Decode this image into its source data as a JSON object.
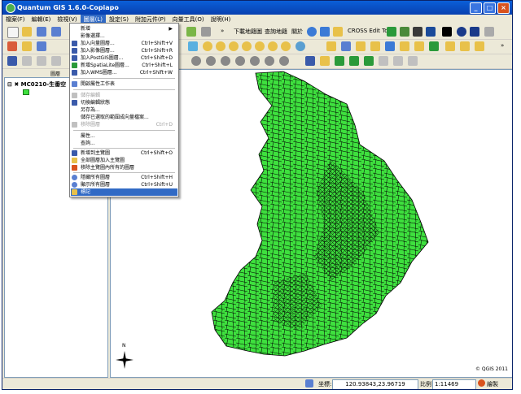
{
  "window": {
    "title": "Quantum GIS 1.6.0-Copiapo",
    "minimize": "_",
    "maximize": "□",
    "close": "×"
  },
  "menubar": [
    {
      "label": "檔案(F)"
    },
    {
      "label": "編輯(E)"
    },
    {
      "label": "檢視(V)"
    },
    {
      "label": "圖層(L)"
    },
    {
      "label": "設定(S)"
    },
    {
      "label": "附加元件(P)"
    },
    {
      "label": "向量工具(O)"
    },
    {
      "label": "說明(H)"
    }
  ],
  "toolbar": {
    "download_map": "下載地籍圖",
    "query_map": "查詢地籍",
    "about": "關於",
    "cross_edit": "CROSS Edit Tool",
    "more_top": "»",
    "more_mid": "»"
  },
  "legend": {
    "title": "圖層",
    "layer_name": "MC0210-生番空"
  },
  "layer_menu": {
    "items": [
      {
        "label": "新增",
        "shortcut": ""
      },
      {
        "label": "影像選擇...",
        "shortcut": ""
      },
      {
        "label": "加入向量圖層...",
        "shortcut": "Ctrl+Shift+V"
      },
      {
        "label": "加入影像圖層...",
        "shortcut": "Ctrl+Shift+R"
      },
      {
        "label": "加入PostGIS圖層...",
        "shortcut": "Ctrl+Shift+D"
      },
      {
        "label": "新增SpatiaLite圖層...",
        "shortcut": "Ctrl+Shift+L"
      },
      {
        "label": "加入WMS圖層...",
        "shortcut": "Ctrl+Shift+W"
      },
      {
        "label": "開啟屬性工作表",
        "shortcut": ""
      },
      {
        "label": "儲存編輯",
        "shortcut": ""
      },
      {
        "label": "切換編輯狀態",
        "shortcut": ""
      },
      {
        "label": "另存為...",
        "shortcut": ""
      },
      {
        "label": "儲存已選取的範圍成向量檔案...",
        "shortcut": ""
      },
      {
        "label": "移除圖層",
        "shortcut": "Ctrl+D"
      },
      {
        "label": "屬性...",
        "shortcut": ""
      },
      {
        "label": "查詢...",
        "shortcut": ""
      },
      {
        "label": "新增到主覽圖",
        "shortcut": "Ctrl+Shift+O"
      },
      {
        "label": "全部圖層加入主覽圖",
        "shortcut": ""
      },
      {
        "label": "移除主覽圖內所有的圖層",
        "shortcut": ""
      },
      {
        "label": "隱藏所有圖層",
        "shortcut": "Ctrl+Shift+H"
      },
      {
        "label": "顯示所有圖層",
        "shortcut": "Ctrl+Shift+U"
      },
      {
        "label": "標記",
        "shortcut": ""
      }
    ]
  },
  "map": {
    "copyright": "© QGIS 2011",
    "north_label": "N",
    "fill_color": "#3ee03e",
    "stroke_color": "#000000"
  },
  "statusbar": {
    "coord_label": "坐標:",
    "coords": "120.93843,23.96719",
    "scale_label": "比例",
    "scale": "1:11469",
    "render_label": "繪製"
  }
}
